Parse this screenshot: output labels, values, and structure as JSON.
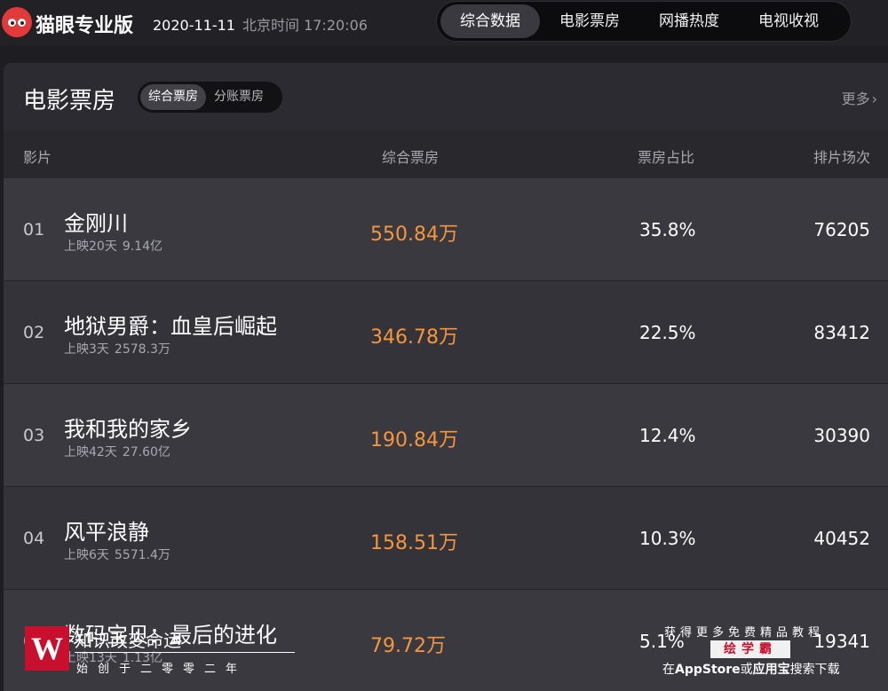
{
  "header": {
    "brand": "猫眼专业版",
    "date": "2020-11-11",
    "beijing_time": "北京时间 17:20:06",
    "nav_tabs": [
      "综合数据",
      "电影票房",
      "网播热度",
      "电视收视"
    ],
    "active_tab": "综合数据"
  },
  "panel": {
    "title": "电影票房",
    "subtabs": [
      "综合票房",
      "分账票房"
    ],
    "active_subtab": "综合票房",
    "more_label": "更多",
    "columns": {
      "film": "影片",
      "box_office": "综合票房",
      "ratio": "票房占比",
      "shows": "排片场次"
    },
    "rows": [
      {
        "rank": "01",
        "name": "金刚川",
        "days": "上映20天",
        "total": "9.14亿",
        "box_office": "550.84万",
        "ratio": "35.8%",
        "shows": "76205"
      },
      {
        "rank": "02",
        "name": "地狱男爵：血皇后崛起",
        "days": "上映3天",
        "total": "2578.3万",
        "box_office": "346.78万",
        "ratio": "22.5%",
        "shows": "83412"
      },
      {
        "rank": "03",
        "name": "我和我的家乡",
        "days": "上映42天",
        "total": "27.60亿",
        "box_office": "190.84万",
        "ratio": "12.4%",
        "shows": "30390"
      },
      {
        "rank": "04",
        "name": "风平浪静",
        "days": "上映6天",
        "total": "5571.4万",
        "box_office": "158.51万",
        "ratio": "10.3%",
        "shows": "40452"
      },
      {
        "rank": "05",
        "name": "数码宝贝：最后的进化",
        "days": "上映13天",
        "total": "1.13亿",
        "box_office": "79.72万",
        "ratio": "5.1%",
        "shows": "19341"
      }
    ]
  },
  "watermarks": {
    "left_logo": "W",
    "left_title": "知识改变命运",
    "left_subtitle": "始创于二零零二年",
    "right_line1": "获得更多免费精品教程",
    "right_brand": "绘学霸",
    "right_line3_a": "在",
    "right_line3_b": "AppStore",
    "right_line3_c": "或",
    "right_line3_d": "应用宝",
    "right_line3_e": "搜索下载"
  }
}
